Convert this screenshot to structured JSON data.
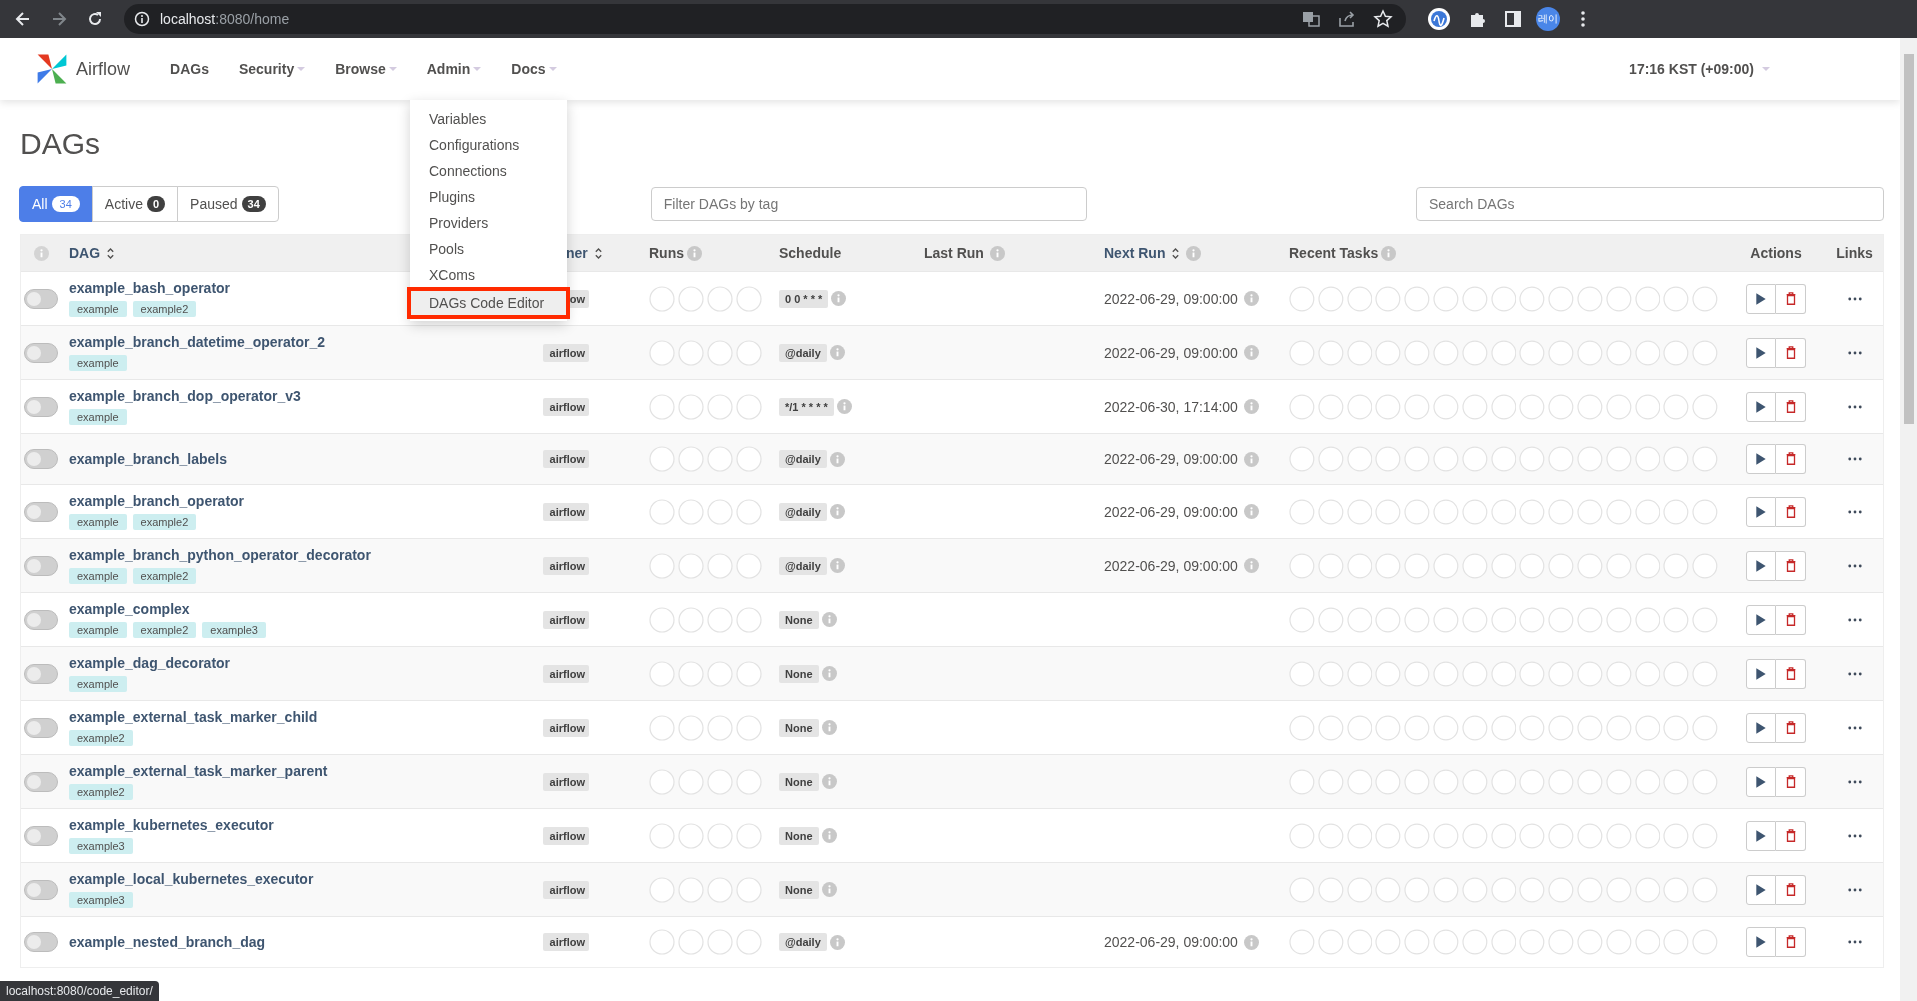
{
  "browser": {
    "url_host": "localhost",
    "url_path": ":8080/home",
    "profile": "레이"
  },
  "nav": {
    "brand": "Airflow",
    "items": [
      {
        "label": "DAGs",
        "dropdown": false
      },
      {
        "label": "Security",
        "dropdown": true
      },
      {
        "label": "Browse",
        "dropdown": true
      },
      {
        "label": "Admin",
        "dropdown": true
      },
      {
        "label": "Docs",
        "dropdown": true
      }
    ],
    "time": "17:16 KST (+09:00)"
  },
  "admin_menu": [
    {
      "label": "Variables",
      "selected": false
    },
    {
      "label": "Configurations",
      "selected": false
    },
    {
      "label": "Connections",
      "selected": false
    },
    {
      "label": "Plugins",
      "selected": false
    },
    {
      "label": "Providers",
      "selected": false
    },
    {
      "label": "Pools",
      "selected": false
    },
    {
      "label": "XComs",
      "selected": false
    },
    {
      "label": "DAGs Code Editor",
      "selected": true
    }
  ],
  "page_title": "DAGs",
  "filter_tabs": [
    {
      "label": "All",
      "count": "34",
      "selected": true
    },
    {
      "label": "Active",
      "count": "0",
      "selected": false
    },
    {
      "label": "Paused",
      "count": "34",
      "selected": false
    }
  ],
  "tag_filter": {
    "placeholder": "Filter DAGs by tag"
  },
  "search": {
    "placeholder": "Search DAGs"
  },
  "table": {
    "columns": [
      {
        "label": "DAG",
        "sortable": true,
        "info": false
      },
      {
        "label": "ner",
        "sortable": true,
        "info": false
      },
      {
        "label": "Runs",
        "sortable": false,
        "info": true
      },
      {
        "label": "Schedule",
        "sortable": false,
        "info": false
      },
      {
        "label": "Last Run",
        "sortable": false,
        "info": true
      },
      {
        "label": "Next Run",
        "sortable": true,
        "info": true
      },
      {
        "label": "Recent Tasks",
        "sortable": false,
        "info": true
      },
      {
        "label": "Actions",
        "sortable": false,
        "info": false
      },
      {
        "label": "Links",
        "sortable": false,
        "info": false
      }
    ],
    "rows": [
      {
        "on": false,
        "name": "example_bash_operator",
        "tags": [
          "example",
          "example2"
        ],
        "owner": "ow",
        "schedule": "0 0 * * *",
        "next_run": "2022-06-29, 09:00:00"
      },
      {
        "on": false,
        "name": "example_branch_datetime_operator_2",
        "tags": [
          "example"
        ],
        "owner": "airflow",
        "schedule": "@daily",
        "next_run": "2022-06-29, 09:00:00"
      },
      {
        "on": false,
        "name": "example_branch_dop_operator_v3",
        "tags": [
          "example"
        ],
        "owner": "airflow",
        "schedule": "*/1 * * * *",
        "next_run": "2022-06-30, 17:14:00"
      },
      {
        "on": false,
        "name": "example_branch_labels",
        "tags": [],
        "owner": "airflow",
        "schedule": "@daily",
        "next_run": "2022-06-29, 09:00:00"
      },
      {
        "on": false,
        "name": "example_branch_operator",
        "tags": [
          "example",
          "example2"
        ],
        "owner": "airflow",
        "schedule": "@daily",
        "next_run": "2022-06-29, 09:00:00"
      },
      {
        "on": false,
        "name": "example_branch_python_operator_decorator",
        "tags": [
          "example",
          "example2"
        ],
        "owner": "airflow",
        "schedule": "@daily",
        "next_run": "2022-06-29, 09:00:00"
      },
      {
        "on": false,
        "name": "example_complex",
        "tags": [
          "example",
          "example2",
          "example3"
        ],
        "owner": "airflow",
        "schedule": "None"
      },
      {
        "on": false,
        "name": "example_dag_decorator",
        "tags": [
          "example"
        ],
        "owner": "airflow",
        "schedule": "None"
      },
      {
        "on": false,
        "name": "example_external_task_marker_child",
        "tags": [
          "example2"
        ],
        "owner": "airflow",
        "schedule": "None"
      },
      {
        "on": false,
        "name": "example_external_task_marker_parent",
        "tags": [
          "example2"
        ],
        "owner": "airflow",
        "schedule": "None"
      },
      {
        "on": false,
        "name": "example_kubernetes_executor",
        "tags": [
          "example3"
        ],
        "owner": "airflow",
        "schedule": "None"
      },
      {
        "on": false,
        "name": "example_local_kubernetes_executor",
        "tags": [
          "example3"
        ],
        "owner": "airflow",
        "schedule": "None"
      },
      {
        "on": false,
        "name": "example_nested_branch_dag",
        "tags": [],
        "owner": "airflow",
        "schedule": "@daily",
        "next_run": "2022-06-29, 09:00:00"
      }
    ]
  },
  "status_url": "localhost:8080/code_editor/"
}
